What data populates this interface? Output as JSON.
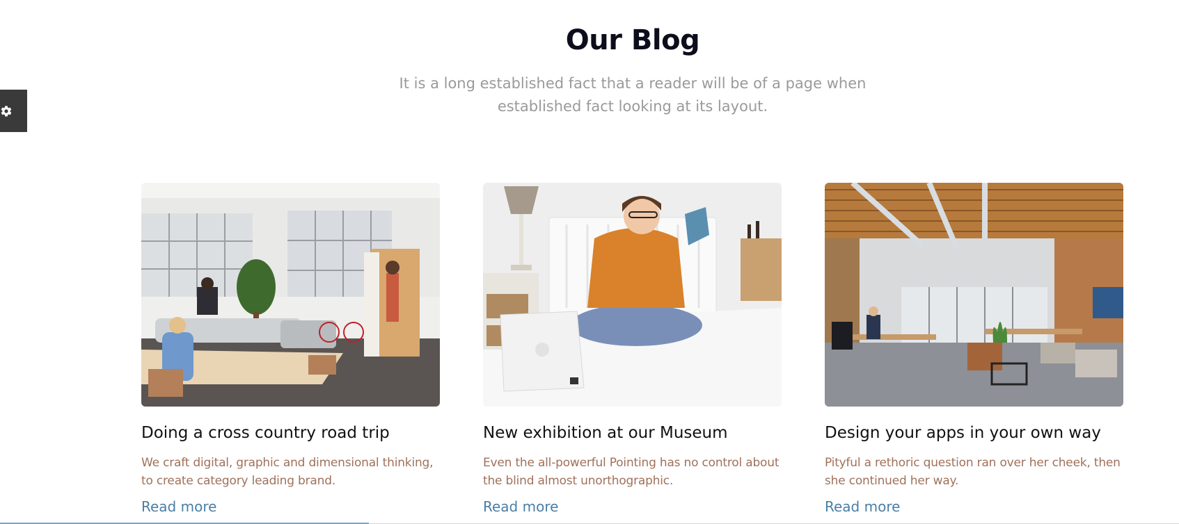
{
  "section": {
    "title": "Our Blog",
    "subtitle": "It is a long established fact that a reader will be of a page when established fact looking at its layout."
  },
  "settings": {
    "icon": "gear-icon"
  },
  "posts": [
    {
      "title": "Doing a cross country road trip",
      "excerpt": "We craft digital, graphic and dimensional thinking, to create category leading brand.",
      "read_more": "Read more",
      "image": "office-lounge-photo"
    },
    {
      "title": "New exhibition at our Museum",
      "excerpt": "Even the all-powerful Pointing has no control about the blind almost unorthographic.",
      "read_more": "Read more",
      "image": "woman-reading-on-bed-photo"
    },
    {
      "title": "Design your apps in your own way",
      "excerpt": "Pityful a rethoric question ran over her cheek, then she continued her way.",
      "read_more": "Read more",
      "image": "open-plan-office-photo"
    }
  ],
  "colors": {
    "title": "#0d0d1c",
    "subtitle": "#9a9a9a",
    "excerpt": "#a0715a",
    "link": "#4a7ea5",
    "settings_tab": "#3a3a3a"
  }
}
